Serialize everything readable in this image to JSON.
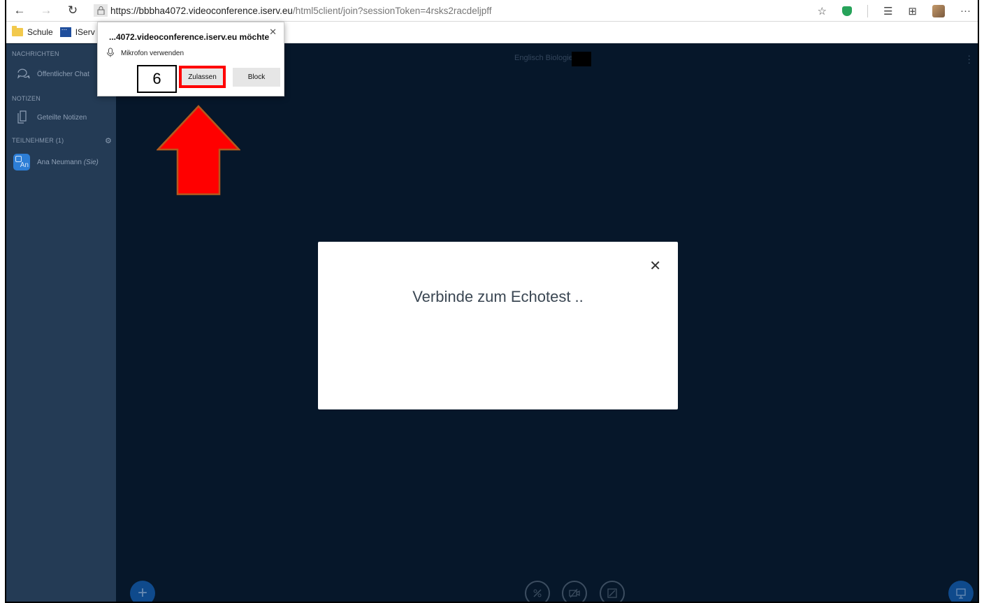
{
  "browser": {
    "url_host": "https://bbbha4072.videoconference.iserv.eu",
    "url_path": "/html5client/join?sessionToken=4rsks2racdeljpff",
    "favorites": [
      {
        "label": "Schule",
        "icon": "folder-icon"
      },
      {
        "label": "IServ -",
        "icon": "iserv-icon"
      }
    ]
  },
  "permission_popup": {
    "title": "...4072.videoconference.iserv.eu möchte",
    "request": "Mikrofon verwenden",
    "allow_label": "Zulassen",
    "block_label": "Block"
  },
  "annotation": {
    "step_number": "6",
    "arrow_color": "#ff0000",
    "highlight_color": "#ff0000"
  },
  "sidebar": {
    "messages_heading": "NACHRICHTEN",
    "public_chat": "Öffentlicher Chat",
    "notes_heading": "NOTIZEN",
    "shared_notes": "Geteilte Notizen",
    "participants_heading": "TEILNEHMER (1)",
    "participant": {
      "initials": "An",
      "name": "Ana Neumann",
      "suffix": "(Sie)"
    }
  },
  "main": {
    "room_title": "Englisch Biologie"
  },
  "modal": {
    "message": "Verbinde zum Echotest .."
  },
  "colors": {
    "sidebar_bg": "#243B55",
    "main_bg": "#06172A",
    "accent": "#0F4A8C"
  }
}
